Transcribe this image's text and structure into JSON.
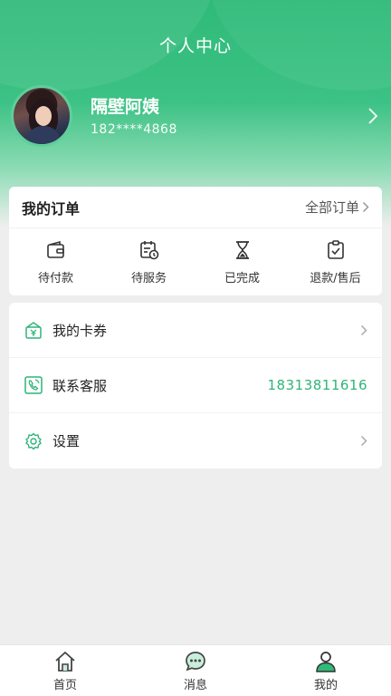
{
  "header": {
    "title": "个人中心"
  },
  "profile": {
    "name": "隔壁阿姨",
    "phone": "182****4868"
  },
  "orders": {
    "title": "我的订单",
    "all_label": "全部订单",
    "items": [
      {
        "label": "待付款",
        "icon": "wallet-icon"
      },
      {
        "label": "待服务",
        "icon": "schedule-icon"
      },
      {
        "label": "已完成",
        "icon": "hourglass-icon"
      },
      {
        "label": "退款/售后",
        "icon": "clipboard-check-icon"
      }
    ]
  },
  "menu": {
    "items": [
      {
        "label": "我的卡券",
        "icon": "coupon-icon",
        "value": ""
      },
      {
        "label": "联系客服",
        "icon": "phone-icon",
        "value": "18313811616"
      },
      {
        "label": "设置",
        "icon": "gear-icon",
        "value": ""
      }
    ]
  },
  "tabbar": {
    "items": [
      {
        "label": "首页",
        "icon": "home-icon"
      },
      {
        "label": "消息",
        "icon": "message-icon"
      },
      {
        "label": "我的",
        "icon": "user-icon"
      }
    ],
    "active_index": 2
  },
  "colors": {
    "brand_green": "#2fba79",
    "accent_text": "#2fb47a"
  }
}
